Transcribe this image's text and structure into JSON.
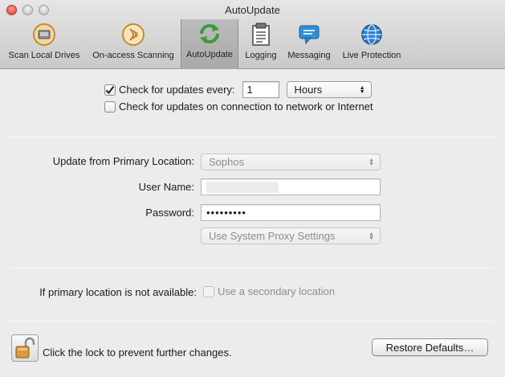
{
  "window": {
    "title": "AutoUpdate"
  },
  "toolbar": {
    "items": [
      {
        "label": "Scan Local Drives",
        "icon": "hard-drive-icon"
      },
      {
        "label": "On-access Scanning",
        "icon": "on-access-scan-icon"
      },
      {
        "label": "AutoUpdate",
        "icon": "autoupdate-icon",
        "selected": true
      },
      {
        "label": "Logging",
        "icon": "logging-icon"
      },
      {
        "label": "Messaging",
        "icon": "messaging-icon"
      },
      {
        "label": "Live Protection",
        "icon": "globe-icon"
      }
    ]
  },
  "schedule": {
    "check_every_label": "Check for updates every:",
    "check_every_checked": true,
    "interval_value": "1",
    "interval_unit": "Hours",
    "on_connection_label": "Check for updates on connection to network or Internet",
    "on_connection_checked": false
  },
  "primary": {
    "location_label": "Update from Primary Location:",
    "location_value": "Sophos",
    "username_label": "User Name:",
    "username_value": "",
    "password_label": "Password:",
    "password_value": "•••••••••",
    "proxy_value": "Use System Proxy Settings"
  },
  "secondary": {
    "label": "If primary location is not available:",
    "checkbox_label": "Use a secondary location",
    "checked": false
  },
  "footer": {
    "lock_text": "Click the lock to prevent further changes.",
    "restore_button": "Restore Defaults…"
  },
  "colors": {
    "accent_green": "#3a9b3a",
    "check_blue": "#2a5fb0"
  }
}
